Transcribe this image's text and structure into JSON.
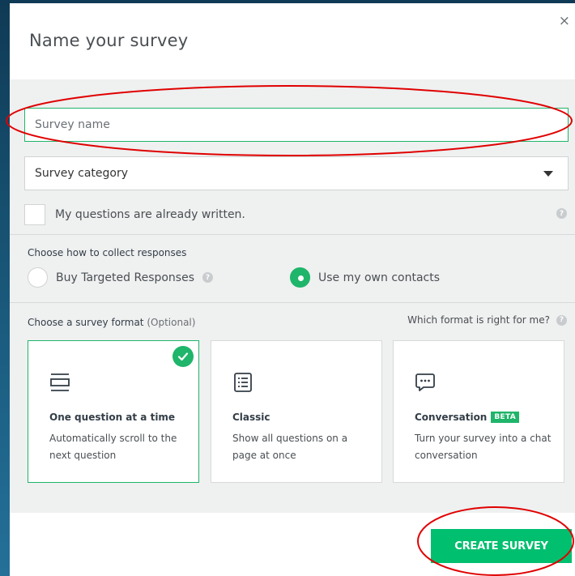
{
  "modal": {
    "title": "Name your survey",
    "close": "×"
  },
  "survey_name": {
    "value": "",
    "placeholder": "Survey name"
  },
  "survey_category": {
    "selected": "Survey category"
  },
  "questions_written": {
    "label": "My questions are already written.",
    "checked": false
  },
  "collect": {
    "label": "Choose how to collect responses",
    "options": [
      {
        "label": "Buy Targeted Responses",
        "selected": false
      },
      {
        "label": "Use my own contacts",
        "selected": true
      }
    ]
  },
  "format": {
    "label": "Choose a survey format",
    "optional": "(Optional)",
    "help_link": "Which format is right for me?",
    "cards": [
      {
        "title": "One question at a time",
        "description": "Automatically scroll to the next question",
        "selected": true,
        "icon": "one-question-icon"
      },
      {
        "title": "Classic",
        "description": "Show all questions on a page at once",
        "selected": false,
        "icon": "classic-list-icon"
      },
      {
        "title": "Conversation",
        "badge": "BETA",
        "description": "Turn your survey into a chat conversation",
        "selected": false,
        "icon": "chat-bubble-icon"
      }
    ]
  },
  "footer": {
    "create_label": "CREATE SURVEY"
  },
  "colors": {
    "accent": "#00bf6f",
    "annotation": "#e00000"
  }
}
